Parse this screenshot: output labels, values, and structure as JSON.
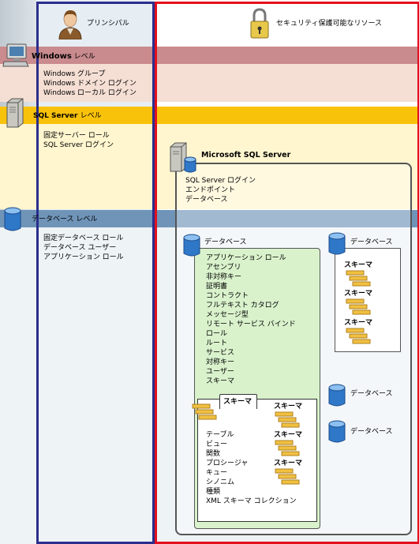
{
  "columns": {
    "principal_title": "プリンシパル",
    "resource_title": "セキュリティ保護可能なリソース"
  },
  "levels": {
    "windows": {
      "label": "Windows レベル",
      "items": [
        "Windows グループ",
        "Windows ドメイン ログイン",
        "Windows ローカル ログイン"
      ]
    },
    "sql_server": {
      "label": "SQL Server レベル",
      "items": [
        "固定サーバー ロール",
        "SQL Server ログイン"
      ]
    },
    "database": {
      "label": "データベース レベル",
      "items": [
        "固定データベース ロール",
        "データベース ユーザー",
        "アプリケーション ロール"
      ]
    }
  },
  "server": {
    "title": "Microsoft SQL Server",
    "items": [
      "SQL Server ログイン",
      "エンドポイント",
      "データベース"
    ]
  },
  "database_main": {
    "title": "データベース",
    "items": [
      "アプリケーション ロール",
      "アセンブリ",
      "非対称キー",
      "証明書",
      "コントラクト",
      "フルテキスト カタログ",
      "メッセージ型",
      "リモート サービス バインド",
      "ロール",
      "ルート",
      "サービス",
      "対称キー",
      "ユーザー",
      "スキーマ"
    ]
  },
  "schema_main": {
    "title": "スキーマ",
    "items": [
      "テーブル",
      "ビュー",
      "関数",
      "プロシージャ",
      "キュー",
      "シノニム",
      "種類",
      "XML スキーマ コレクション"
    ]
  },
  "schema_small_label": "スキーマ",
  "database_other": {
    "title": "データベース",
    "schema_label": "スキーマ"
  },
  "database_extra_1": "データベース",
  "database_extra_2": "データベース",
  "colors": {
    "principal_border": "#2b2e8c",
    "resource_border": "#e3101d",
    "windows_band": "#c98b8e",
    "sql_band": "#f9c20a",
    "db_band": "#6f94b8"
  }
}
